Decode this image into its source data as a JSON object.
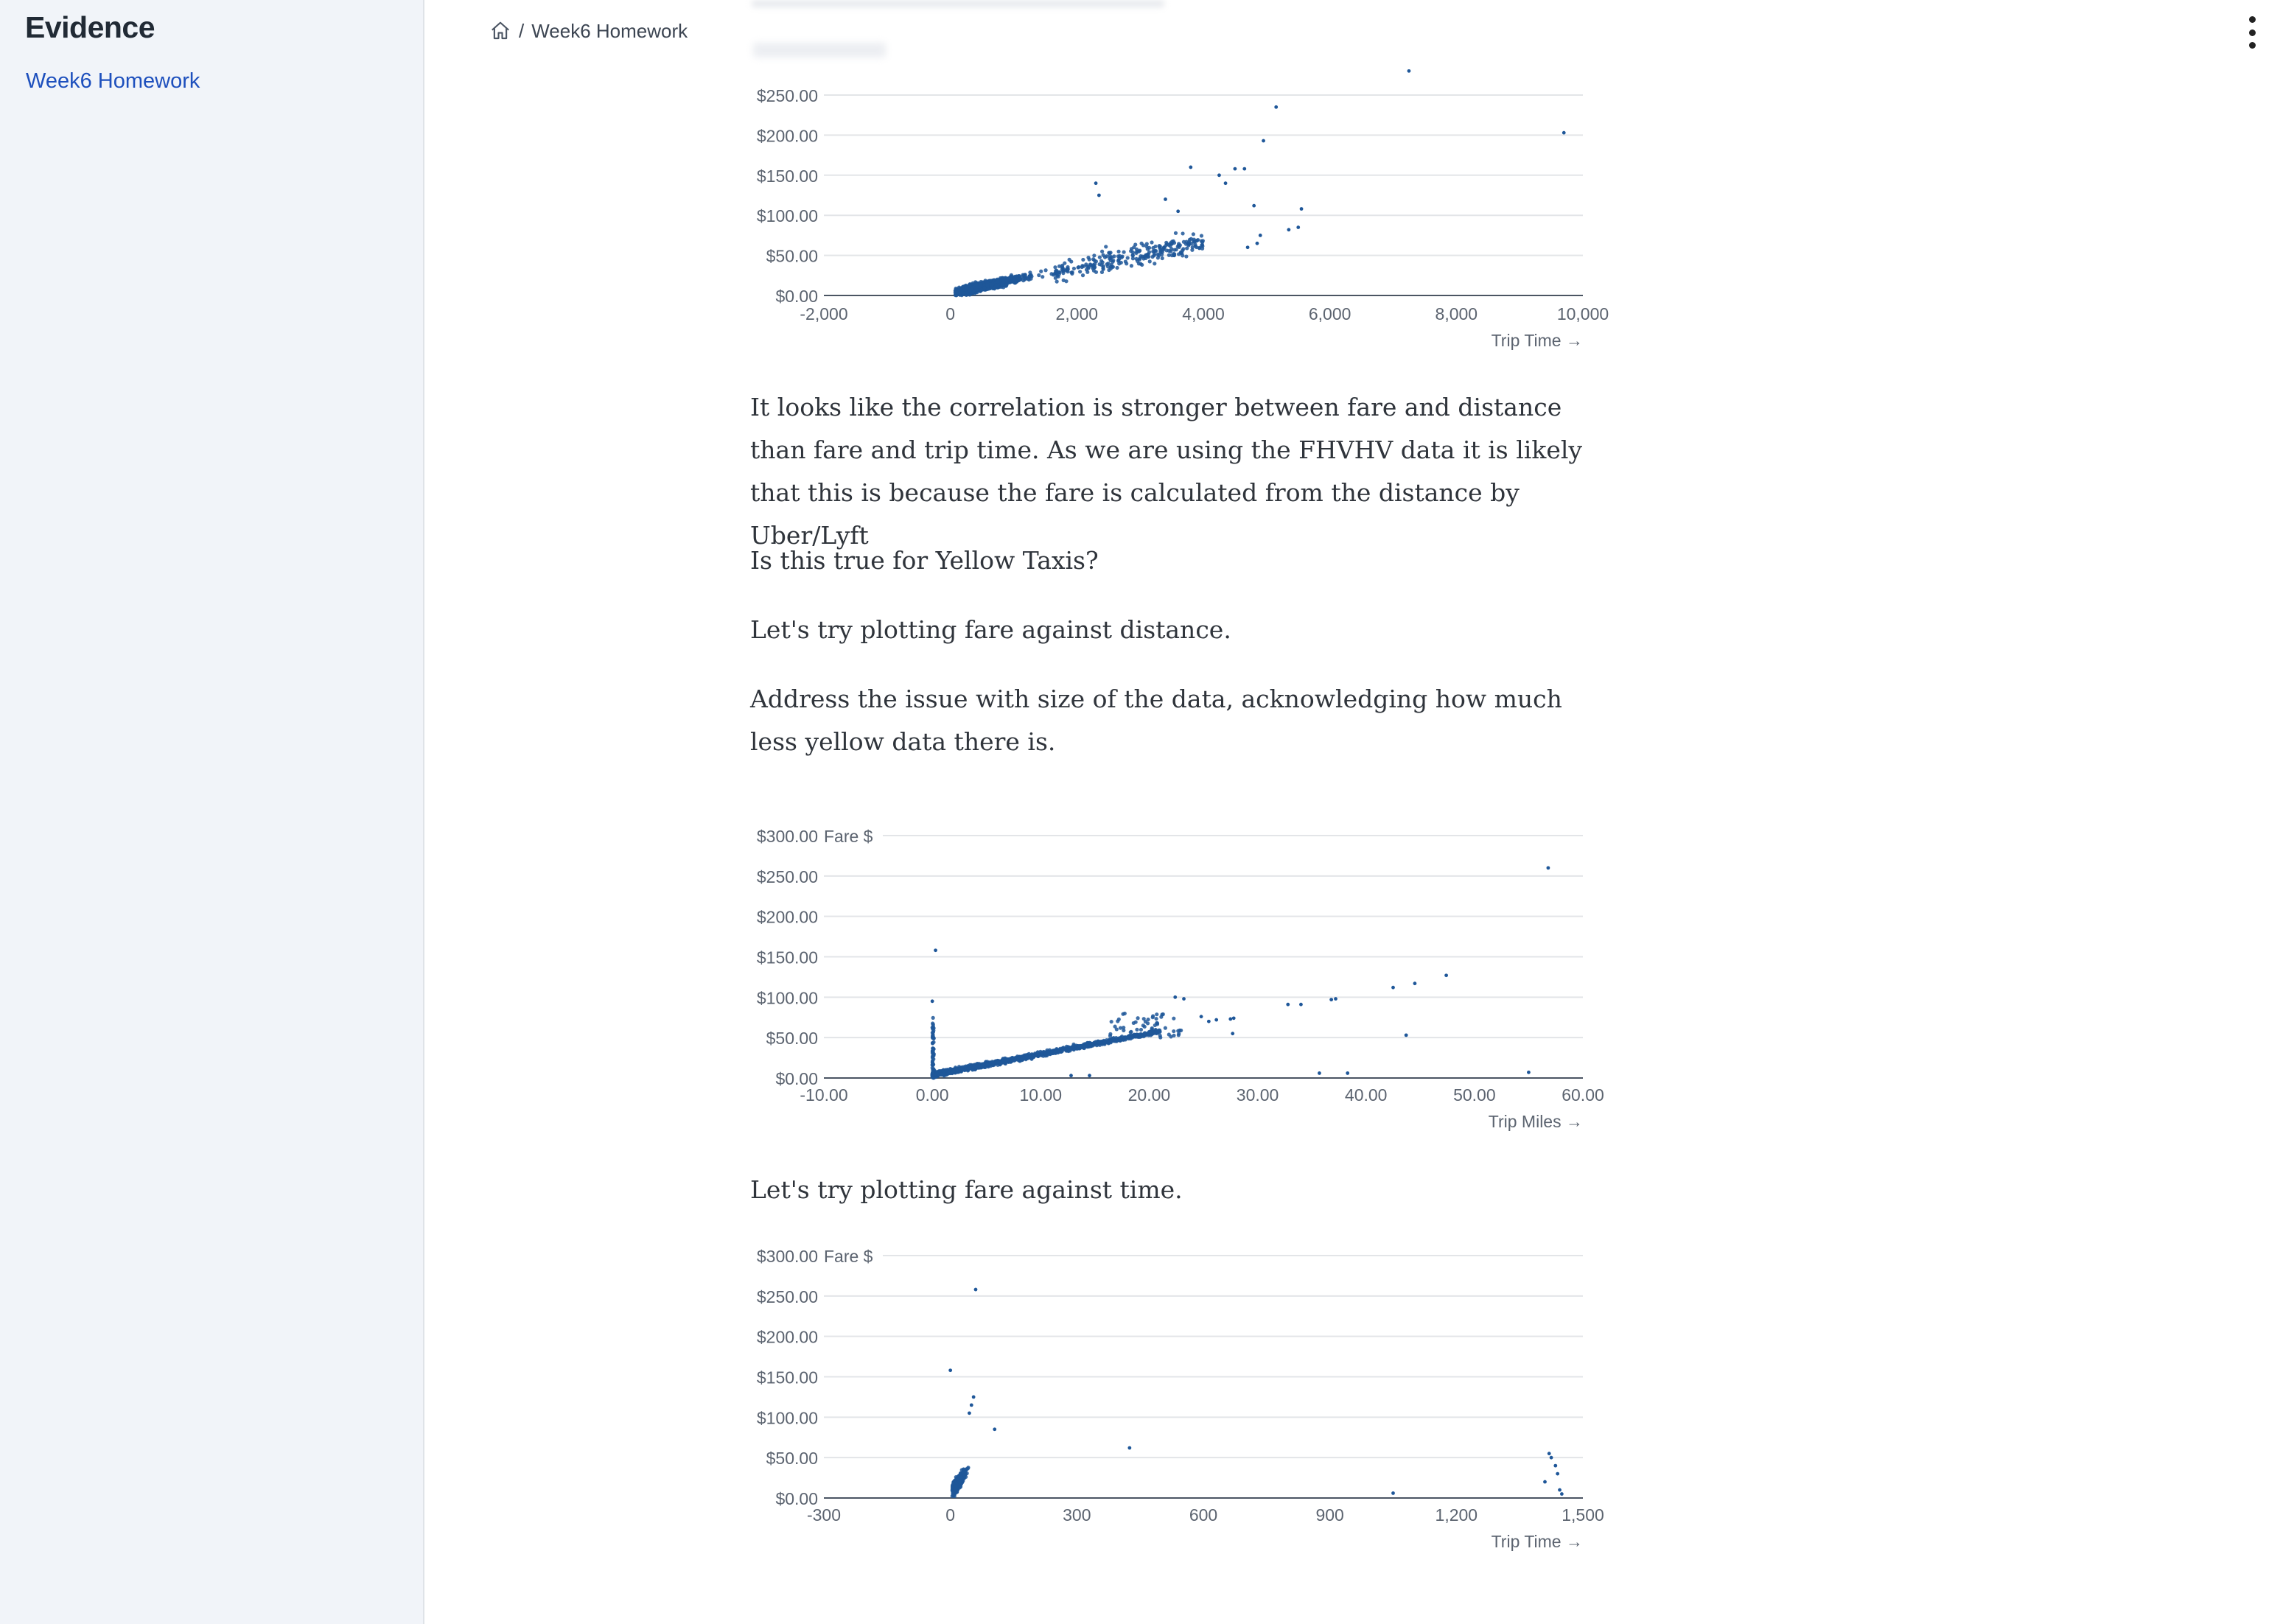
{
  "sidebar": {
    "brand": "Evidence",
    "items": [
      {
        "label": "Week6 Homework"
      }
    ]
  },
  "breadcrumb": {
    "separator": "/",
    "current": "Week6 Homework"
  },
  "icons": {
    "home": "home-icon",
    "menu": "kebab-menu-icon"
  },
  "paragraphs": {
    "p1": "It looks like the correlation is stronger between fare and distance than fare and trip time. As we are using the FHVHV data it is likely that this is because the fare is calculated from the distance by Uber/Lyft",
    "p2": "Is this true for Yellow Taxis?",
    "p3": "Let's try plotting fare against distance.",
    "p4": "Address the issue with size of the data, acknowledging how much less yellow data there is.",
    "p5": "Let's try plotting fare against time."
  },
  "colors": {
    "series": "#1f5799",
    "accent": "#1d4fbd"
  },
  "chart_data": [
    {
      "type": "scatter",
      "title": "",
      "xlabel": "Trip Time →",
      "ylabel": "",
      "xlim": [
        -2000,
        10000
      ],
      "ylim": [
        0,
        250
      ],
      "x_ticks": [
        "-2,000",
        "0",
        "2,000",
        "4,000",
        "6,000",
        "8,000",
        "10,000"
      ],
      "y_ticks": [
        "$0.00",
        "$50.00",
        "$100.00",
        "$150.00",
        "$200.00",
        "$250.00"
      ],
      "grid": true,
      "outliers": [
        {
          "x": 7250,
          "y": 280
        },
        {
          "x": 5150,
          "y": 235
        },
        {
          "x": 9700,
          "y": 203
        },
        {
          "x": 4950,
          "y": 193
        },
        {
          "x": 3800,
          "y": 160
        },
        {
          "x": 4500,
          "y": 158
        },
        {
          "x": 4650,
          "y": 158
        },
        {
          "x": 4250,
          "y": 150
        },
        {
          "x": 4350,
          "y": 140
        },
        {
          "x": 4800,
          "y": 112
        },
        {
          "x": 5550,
          "y": 108
        },
        {
          "x": 5500,
          "y": 85
        },
        {
          "x": 5350,
          "y": 82
        },
        {
          "x": 4900,
          "y": 75
        },
        {
          "x": 4850,
          "y": 65
        },
        {
          "x": 3600,
          "y": 105
        },
        {
          "x": 3400,
          "y": 120
        },
        {
          "x": 2300,
          "y": 140
        },
        {
          "x": 2350,
          "y": 125
        },
        {
          "x": 4700,
          "y": 60
        }
      ]
    },
    {
      "type": "scatter",
      "title": "",
      "xlabel": "Trip Miles →",
      "ylabel": "Fare $",
      "xlim": [
        -10,
        60
      ],
      "ylim": [
        0,
        300
      ],
      "x_ticks": [
        "-10.00",
        "0.00",
        "10.00",
        "20.00",
        "30.00",
        "40.00",
        "50.00",
        "60.00"
      ],
      "y_ticks": [
        "$0.00",
        "$50.00",
        "$100.00",
        "$150.00",
        "$200.00",
        "$250.00",
        "$300.00"
      ],
      "grid": true,
      "outliers": [
        {
          "x": 56.8,
          "y": 260
        },
        {
          "x": 0.3,
          "y": 158
        },
        {
          "x": 0,
          "y": 95
        },
        {
          "x": 47.4,
          "y": 127
        },
        {
          "x": 44.5,
          "y": 117
        },
        {
          "x": 42.5,
          "y": 112
        },
        {
          "x": 37.2,
          "y": 98
        },
        {
          "x": 36.8,
          "y": 97
        },
        {
          "x": 34,
          "y": 91
        },
        {
          "x": 32.8,
          "y": 91
        },
        {
          "x": 27.5,
          "y": 73
        },
        {
          "x": 27.8,
          "y": 74
        },
        {
          "x": 25.5,
          "y": 70
        },
        {
          "x": 26.2,
          "y": 72
        },
        {
          "x": 24.8,
          "y": 76
        },
        {
          "x": 23.2,
          "y": 98
        },
        {
          "x": 22.4,
          "y": 100
        },
        {
          "x": 43.7,
          "y": 53
        },
        {
          "x": 27.7,
          "y": 55
        },
        {
          "x": 55,
          "y": 7
        },
        {
          "x": 35.7,
          "y": 6
        },
        {
          "x": 38.3,
          "y": 6
        },
        {
          "x": 12.8,
          "y": 3
        },
        {
          "x": 14.5,
          "y": 3
        }
      ]
    },
    {
      "type": "scatter",
      "title": "",
      "xlabel": "Trip Time →",
      "ylabel": "Fare $",
      "xlim": [
        -300,
        1500
      ],
      "ylim": [
        0,
        300
      ],
      "x_ticks": [
        "-300",
        "0",
        "300",
        "600",
        "900",
        "1,200",
        "1,500"
      ],
      "y_ticks": [
        "$0.00",
        "$50.00",
        "$100.00",
        "$150.00",
        "$200.00",
        "$250.00",
        "$300.00"
      ],
      "grid": true,
      "outliers": [
        {
          "x": 60,
          "y": 258
        },
        {
          "x": 0,
          "y": 158
        },
        {
          "x": 55,
          "y": 125
        },
        {
          "x": 50,
          "y": 115
        },
        {
          "x": 45,
          "y": 105
        },
        {
          "x": 105,
          "y": 85
        },
        {
          "x": 425,
          "y": 62
        },
        {
          "x": 1050,
          "y": 6
        },
        {
          "x": 1420,
          "y": 55
        },
        {
          "x": 1425,
          "y": 50
        },
        {
          "x": 1435,
          "y": 40
        },
        {
          "x": 1440,
          "y": 30
        },
        {
          "x": 1410,
          "y": 20
        },
        {
          "x": 1445,
          "y": 10
        },
        {
          "x": 1450,
          "y": 5
        }
      ]
    }
  ]
}
